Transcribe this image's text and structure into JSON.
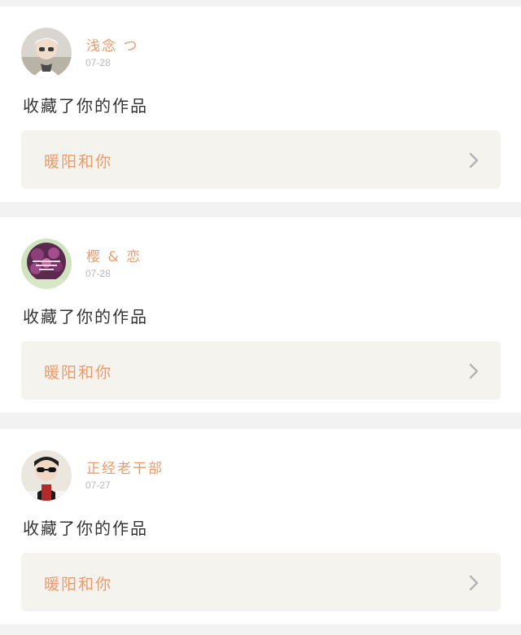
{
  "notifications": [
    {
      "username": "浅念 つ",
      "date": "07-28",
      "message": "收藏了你的作品",
      "work_title": "暖阳和你",
      "avatar_icon": "user-avatar-photo"
    },
    {
      "username": "樱 & 恋",
      "date": "07-28",
      "message": "收藏了你的作品",
      "work_title": "暖阳和你",
      "avatar_icon": "user-avatar-flower"
    },
    {
      "username": "正经老干部",
      "date": "07-27",
      "message": "收藏了你的作品",
      "work_title": "暖阳和你",
      "avatar_icon": "user-avatar-photo"
    }
  ],
  "colors": {
    "accent": "#ee9a68",
    "date": "#b9b9b9",
    "text": "#333333",
    "work_bg": "#f4f3ee",
    "page_bg": "#f2f2f2"
  }
}
